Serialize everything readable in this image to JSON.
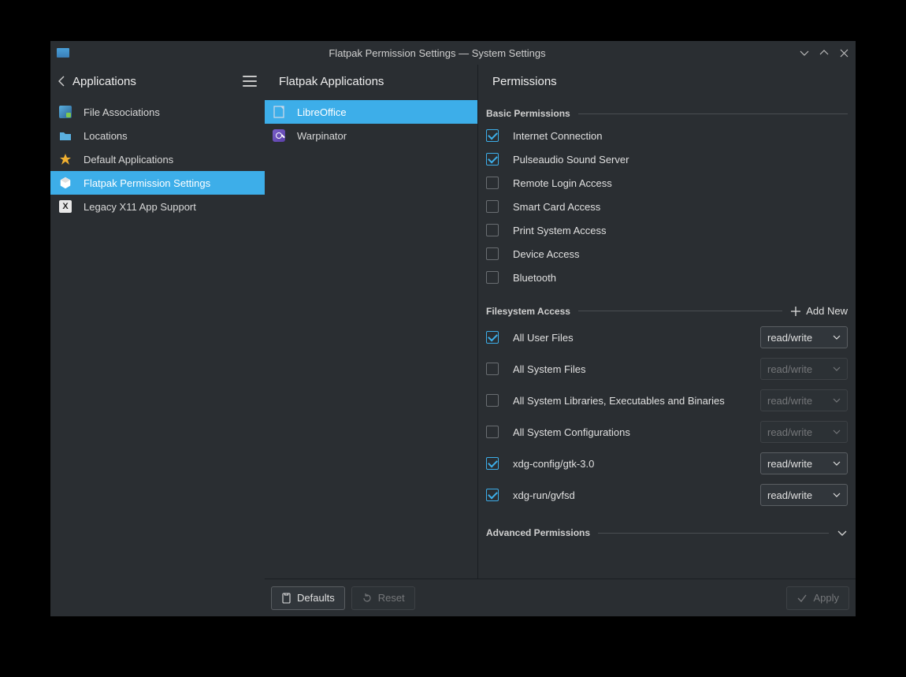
{
  "window_title": "Flatpak Permission Settings — System Settings",
  "sidebar": {
    "back_label": "Applications",
    "items": [
      {
        "id": "file-associations",
        "label": "File Associations",
        "selected": false
      },
      {
        "id": "locations",
        "label": "Locations",
        "selected": false
      },
      {
        "id": "default-applications",
        "label": "Default Applications",
        "selected": false
      },
      {
        "id": "flatpak-permission-settings",
        "label": "Flatpak Permission Settings",
        "selected": true
      },
      {
        "id": "legacy-x11-app-support",
        "label": "Legacy X11 App Support",
        "selected": false
      }
    ]
  },
  "middle": {
    "title": "Flatpak Applications",
    "apps": [
      {
        "id": "libreoffice",
        "label": "LibreOffice",
        "selected": true
      },
      {
        "id": "warpinator",
        "label": "Warpinator",
        "selected": false
      }
    ]
  },
  "permissions": {
    "title": "Permissions",
    "basic_label": "Basic Permissions",
    "basic": [
      {
        "id": "internet",
        "label": "Internet Connection",
        "checked": true
      },
      {
        "id": "pulseaudio",
        "label": "Pulseaudio Sound Server",
        "checked": true
      },
      {
        "id": "remote-login",
        "label": "Remote Login Access",
        "checked": false
      },
      {
        "id": "smart-card",
        "label": "Smart Card Access",
        "checked": false
      },
      {
        "id": "print-system",
        "label": "Print System Access",
        "checked": false
      },
      {
        "id": "device-access",
        "label": "Device Access",
        "checked": false
      },
      {
        "id": "bluetooth",
        "label": "Bluetooth",
        "checked": false
      }
    ],
    "filesystem_label": "Filesystem Access",
    "add_new_label": "Add New",
    "filesystem": [
      {
        "id": "all-user-files",
        "label": "All User Files",
        "checked": true,
        "mode": "read/write"
      },
      {
        "id": "all-system-files",
        "label": "All System Files",
        "checked": false,
        "mode": "read/write"
      },
      {
        "id": "all-system-libs",
        "label": "All System Libraries, Executables and Binaries",
        "checked": false,
        "mode": "read/write"
      },
      {
        "id": "all-system-configs",
        "label": "All System Configurations",
        "checked": false,
        "mode": "read/write"
      },
      {
        "id": "xdg-config-gtk",
        "label": "xdg-config/gtk-3.0",
        "checked": true,
        "mode": "read/write"
      },
      {
        "id": "xdg-run-gvfsd",
        "label": "xdg-run/gvfsd",
        "checked": true,
        "mode": "read/write"
      }
    ],
    "advanced_label": "Advanced Permissions"
  },
  "buttons": {
    "defaults": "Defaults",
    "reset": "Reset",
    "apply": "Apply"
  }
}
